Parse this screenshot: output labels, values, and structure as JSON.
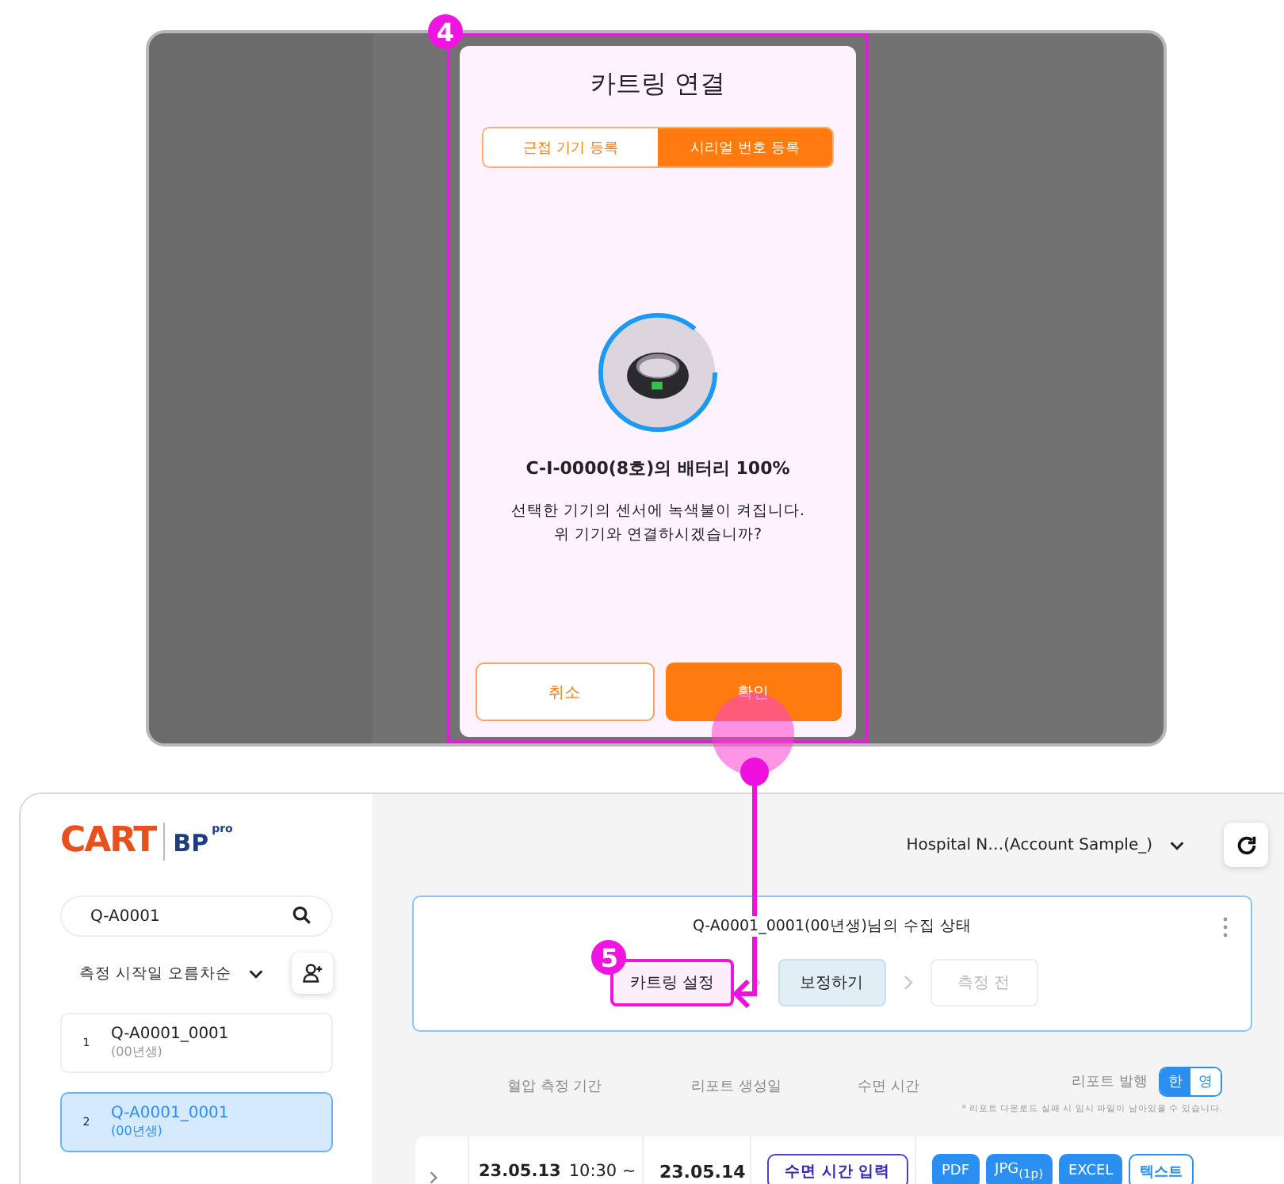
{
  "annotations": {
    "modal_badge": "4",
    "step_badge": "5"
  },
  "modal": {
    "title": "카트링 연결",
    "tabs": [
      {
        "label": "근접 기기 등록",
        "selected": false
      },
      {
        "label": "시리얼 번호 등록",
        "selected": true
      }
    ],
    "battery": "C-I-0000(8호)의 배터리 100%",
    "message_lines": [
      "선택한 기기의 센서에 녹색불이 켜집니다.",
      "위 기기와 연결하시겠습니까?"
    ],
    "cancel": "취소",
    "confirm": "확인"
  },
  "sidebar": {
    "logo": {
      "brand": "CART",
      "product": "BP",
      "tier": "pro"
    },
    "search": {
      "value": "Q-A0001"
    },
    "sort": "측정 시작일 오름차순",
    "patients": [
      {
        "number": "1",
        "name": "Q-A0001_0001",
        "birth": "(00년생)",
        "selected": false
      },
      {
        "number": "2",
        "name": "Q-A0001_0001",
        "birth": "(00년생)",
        "selected": true
      }
    ]
  },
  "header": {
    "account": "Hospital N…(Account Sample_)"
  },
  "status_card": {
    "title": "Q-A0001_0001(00년생)님의 수집 상태",
    "steps": [
      {
        "label": "카트링 설정",
        "kind": "outline",
        "highlighted": true
      },
      {
        "label": "보정하기",
        "kind": "filled",
        "highlighted": false
      },
      {
        "label": "측정 전",
        "kind": "disabled",
        "highlighted": false
      }
    ]
  },
  "table": {
    "columns": [
      "혈압 측정 기간",
      "리포트 생성일",
      "수면 시간",
      "리포트 발행"
    ],
    "languages": [
      {
        "label": "한",
        "selected": true
      },
      {
        "label": "영",
        "selected": false
      }
    ],
    "note": "* 리포트 다운로드 실패 시 임시 파일이 남아있을 수 있습니다.",
    "rows": [
      {
        "start_date": "23.05.13",
        "start_time": "10:30 ~",
        "report_date": "23.05.14",
        "sleep_button": "수면 시간 입력",
        "exports": [
          {
            "label": "PDF",
            "kind": "filled"
          },
          {
            "label": "JPG$_{(1p)}$",
            "kind": "filled"
          },
          {
            "label": "EXCEL",
            "kind": "filled"
          },
          {
            "label": "텍스트",
            "kind": "outline"
          }
        ]
      }
    ]
  }
}
